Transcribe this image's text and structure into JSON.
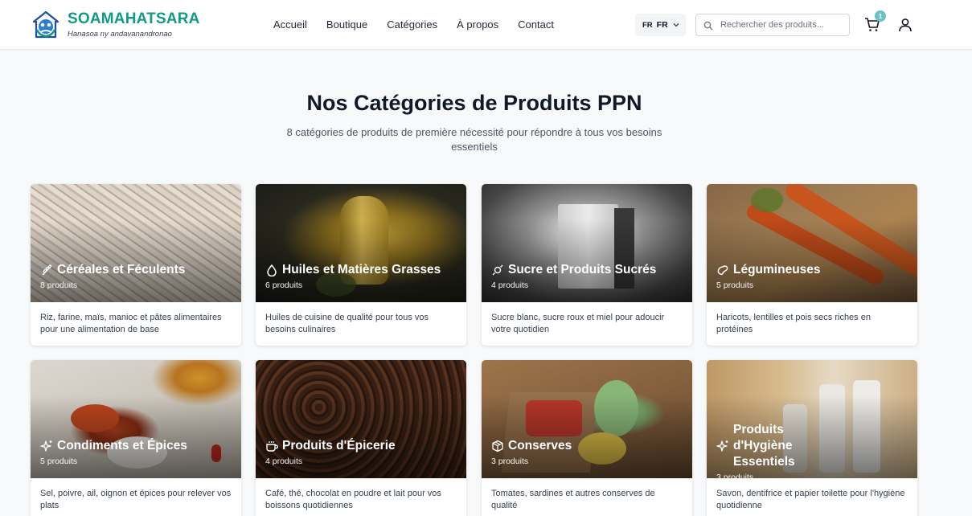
{
  "header": {
    "brand_name": "SOAMAHATSARA",
    "brand_tagline": "Hanasoa ny andavanandronao",
    "nav": [
      "Accueil",
      "Boutique",
      "Catégories",
      "À propos",
      "Contact"
    ],
    "lang_flag": "FR",
    "lang_code": "FR",
    "search_placeholder": "Rechercher des produits...",
    "cart_count": "1",
    "colors": {
      "brand": "#0f9b86",
      "badge": "#67c3c7"
    }
  },
  "page": {
    "title": "Nos Catégories de Produits PPN",
    "subtitle": "8 catégories de produits de première nécessité pour répondre à tous vos besoins essentiels"
  },
  "categories": [
    {
      "name": "Céréales et Féculents",
      "count": "8 produits",
      "description": "Riz, farine, maïs, manioc et pâtes alimentaires pour une alimentation de base",
      "icon": "wheat-icon"
    },
    {
      "name": "Huiles et Matières Grasses",
      "count": "6 produits",
      "description": "Huiles de cuisine de qualité pour tous vos besoins culinaires",
      "icon": "droplet-icon"
    },
    {
      "name": "Sucre et Produits Sucrés",
      "count": "4 produits",
      "description": "Sucre blanc, sucre roux et miel pour adoucir votre quotidien",
      "icon": "candy-icon"
    },
    {
      "name": "Légumineuses",
      "count": "5 produits",
      "description": "Haricots, lentilles et pois secs riches en protéines",
      "icon": "bean-icon"
    },
    {
      "name": "Condiments et Épices",
      "count": "5 produits",
      "description": "Sel, poivre, ail, oignon et épices pour relever vos plats",
      "icon": "sparkles-icon"
    },
    {
      "name": "Produits d'Épicerie",
      "count": "4 produits",
      "description": "Café, thé, chocolat en poudre et lait pour vos boissons quotidiennes",
      "icon": "coffee-icon"
    },
    {
      "name": "Conserves",
      "count": "3 produits",
      "description": "Tomates, sardines et autres conserves de qualité",
      "icon": "package-icon"
    },
    {
      "name": "Produits d'Hygiène Essentiels",
      "count": "3 produits",
      "description": "Savon, dentifrice et papier toilette pour l'hygiène quotidienne",
      "icon": "sparkles-icon"
    }
  ]
}
